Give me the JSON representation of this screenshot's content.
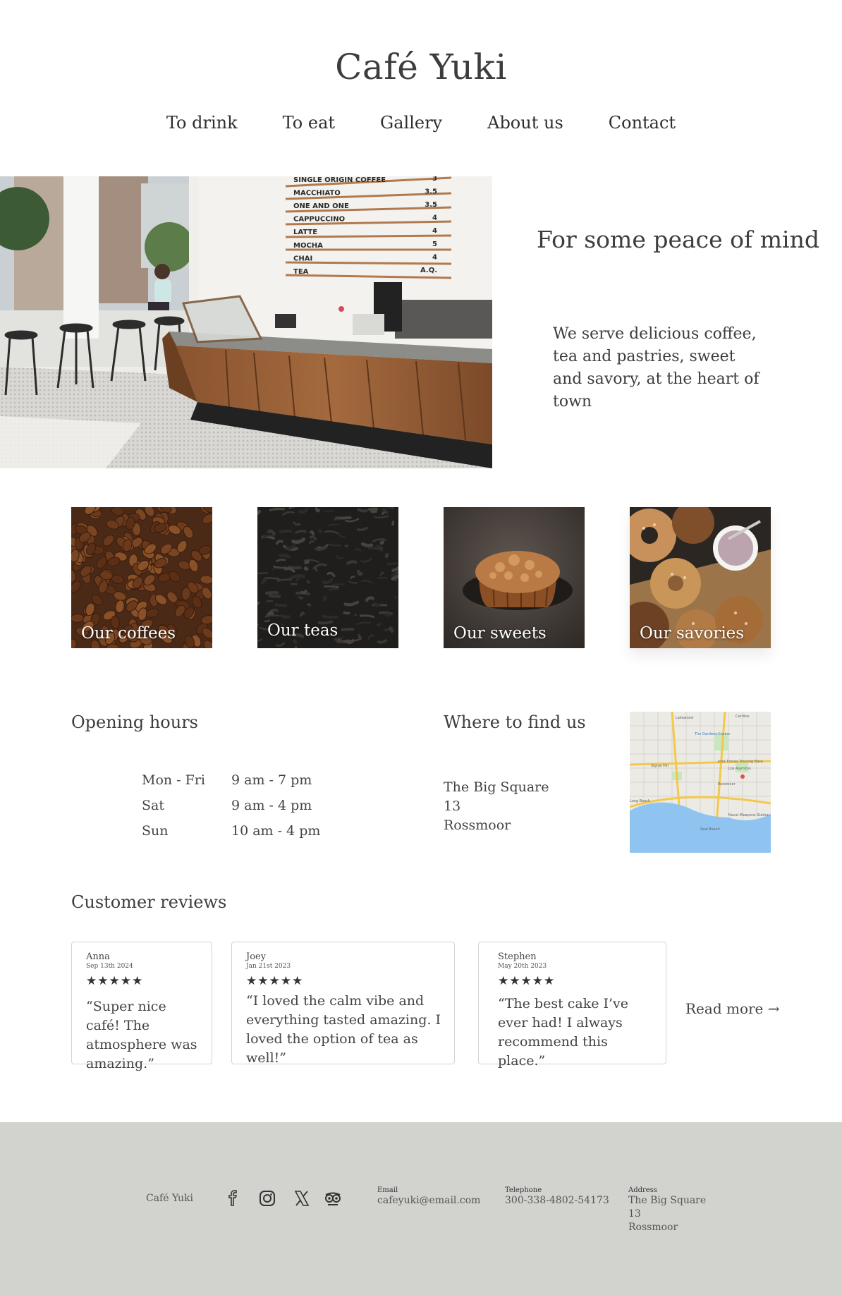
{
  "header": {
    "title": "Café Yuki",
    "nav": [
      "To drink",
      "To eat",
      "Gallery",
      "About us",
      "Contact"
    ]
  },
  "hero": {
    "tagline": "For some peace of mind",
    "text": "We serve delicious coffee, tea and pastries, sweet and savory, at the heart of town",
    "menu_board": [
      {
        "item": "SINGLE ORIGIN COFFEE",
        "price": "3"
      },
      {
        "item": "MACCHIATO",
        "price": "3.5"
      },
      {
        "item": "ONE AND ONE",
        "price": "3.5"
      },
      {
        "item": "CAPPUCCINO",
        "price": "4"
      },
      {
        "item": "LATTE",
        "price": "4"
      },
      {
        "item": "MOCHA",
        "price": "5"
      },
      {
        "item": "CHAI",
        "price": "4"
      },
      {
        "item": "TEA",
        "price": "A.Q."
      }
    ]
  },
  "categories": [
    {
      "label": "Our coffees"
    },
    {
      "label": "Our teas"
    },
    {
      "label": "Our sweets"
    },
    {
      "label": "Our savories"
    }
  ],
  "hours": {
    "heading": "Opening hours",
    "rows": [
      {
        "day": "Mon - Fri",
        "time": "9 am - 7 pm"
      },
      {
        "day": "Sat",
        "time": "9 am - 4 pm"
      },
      {
        "day": "Sun",
        "time": "10 am - 4 pm"
      }
    ]
  },
  "location": {
    "heading": "Where to find us",
    "address": [
      "The Big Square",
      "13",
      "Rossmoor"
    ]
  },
  "reviews": {
    "heading": "Customer reviews",
    "items": [
      {
        "name": "Anna",
        "date": "Sep 13th 2024",
        "stars": "★★★★★",
        "text": "“Super nice café! The atmosphere was amazing.”"
      },
      {
        "name": "Joey",
        "date": "Jan 21st 2023",
        "stars": "★★★★★",
        "text": "“I loved the calm vibe and everything tasted amazing. I loved the option of tea as well!”"
      },
      {
        "name": "Stephen",
        "date": "May 20th 2023",
        "stars": "★★★★★",
        "text": "“The best cake I’ve ever had! I always recommend this place.”"
      }
    ],
    "read_more": "Read more →"
  },
  "footer": {
    "brand": "Café Yuki",
    "icons": [
      "facebook-icon",
      "instagram-icon",
      "x-icon",
      "tripadvisor-icon"
    ],
    "email_label": "Email",
    "email": "cafeyuki@email.com",
    "phone_label": "Telephone",
    "phone": "300-338-4802-54173",
    "address_label": "Address",
    "address": [
      "The Big Square",
      "13",
      "Rossmoor"
    ]
  },
  "colors": {
    "footer_bg": "#d2d3cf",
    "text": "#3d3d3d",
    "map_water": "#8fc3f0"
  }
}
